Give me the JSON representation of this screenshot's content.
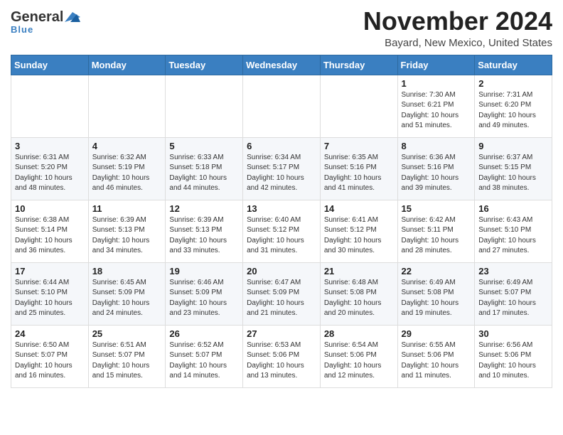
{
  "header": {
    "logo": {
      "general": "General",
      "blue": "Blue",
      "tagline": "Blue"
    },
    "month": "November 2024",
    "location": "Bayard, New Mexico, United States"
  },
  "weekdays": [
    "Sunday",
    "Monday",
    "Tuesday",
    "Wednesday",
    "Thursday",
    "Friday",
    "Saturday"
  ],
  "weeks": [
    [
      {
        "day": "",
        "info": ""
      },
      {
        "day": "",
        "info": ""
      },
      {
        "day": "",
        "info": ""
      },
      {
        "day": "",
        "info": ""
      },
      {
        "day": "",
        "info": ""
      },
      {
        "day": "1",
        "info": "Sunrise: 7:30 AM\nSunset: 6:21 PM\nDaylight: 10 hours\nand 51 minutes."
      },
      {
        "day": "2",
        "info": "Sunrise: 7:31 AM\nSunset: 6:20 PM\nDaylight: 10 hours\nand 49 minutes."
      }
    ],
    [
      {
        "day": "3",
        "info": "Sunrise: 6:31 AM\nSunset: 5:20 PM\nDaylight: 10 hours\nand 48 minutes."
      },
      {
        "day": "4",
        "info": "Sunrise: 6:32 AM\nSunset: 5:19 PM\nDaylight: 10 hours\nand 46 minutes."
      },
      {
        "day": "5",
        "info": "Sunrise: 6:33 AM\nSunset: 5:18 PM\nDaylight: 10 hours\nand 44 minutes."
      },
      {
        "day": "6",
        "info": "Sunrise: 6:34 AM\nSunset: 5:17 PM\nDaylight: 10 hours\nand 42 minutes."
      },
      {
        "day": "7",
        "info": "Sunrise: 6:35 AM\nSunset: 5:16 PM\nDaylight: 10 hours\nand 41 minutes."
      },
      {
        "day": "8",
        "info": "Sunrise: 6:36 AM\nSunset: 5:16 PM\nDaylight: 10 hours\nand 39 minutes."
      },
      {
        "day": "9",
        "info": "Sunrise: 6:37 AM\nSunset: 5:15 PM\nDaylight: 10 hours\nand 38 minutes."
      }
    ],
    [
      {
        "day": "10",
        "info": "Sunrise: 6:38 AM\nSunset: 5:14 PM\nDaylight: 10 hours\nand 36 minutes."
      },
      {
        "day": "11",
        "info": "Sunrise: 6:39 AM\nSunset: 5:13 PM\nDaylight: 10 hours\nand 34 minutes."
      },
      {
        "day": "12",
        "info": "Sunrise: 6:39 AM\nSunset: 5:13 PM\nDaylight: 10 hours\nand 33 minutes."
      },
      {
        "day": "13",
        "info": "Sunrise: 6:40 AM\nSunset: 5:12 PM\nDaylight: 10 hours\nand 31 minutes."
      },
      {
        "day": "14",
        "info": "Sunrise: 6:41 AM\nSunset: 5:12 PM\nDaylight: 10 hours\nand 30 minutes."
      },
      {
        "day": "15",
        "info": "Sunrise: 6:42 AM\nSunset: 5:11 PM\nDaylight: 10 hours\nand 28 minutes."
      },
      {
        "day": "16",
        "info": "Sunrise: 6:43 AM\nSunset: 5:10 PM\nDaylight: 10 hours\nand 27 minutes."
      }
    ],
    [
      {
        "day": "17",
        "info": "Sunrise: 6:44 AM\nSunset: 5:10 PM\nDaylight: 10 hours\nand 25 minutes."
      },
      {
        "day": "18",
        "info": "Sunrise: 6:45 AM\nSunset: 5:09 PM\nDaylight: 10 hours\nand 24 minutes."
      },
      {
        "day": "19",
        "info": "Sunrise: 6:46 AM\nSunset: 5:09 PM\nDaylight: 10 hours\nand 23 minutes."
      },
      {
        "day": "20",
        "info": "Sunrise: 6:47 AM\nSunset: 5:09 PM\nDaylight: 10 hours\nand 21 minutes."
      },
      {
        "day": "21",
        "info": "Sunrise: 6:48 AM\nSunset: 5:08 PM\nDaylight: 10 hours\nand 20 minutes."
      },
      {
        "day": "22",
        "info": "Sunrise: 6:49 AM\nSunset: 5:08 PM\nDaylight: 10 hours\nand 19 minutes."
      },
      {
        "day": "23",
        "info": "Sunrise: 6:49 AM\nSunset: 5:07 PM\nDaylight: 10 hours\nand 17 minutes."
      }
    ],
    [
      {
        "day": "24",
        "info": "Sunrise: 6:50 AM\nSunset: 5:07 PM\nDaylight: 10 hours\nand 16 minutes."
      },
      {
        "day": "25",
        "info": "Sunrise: 6:51 AM\nSunset: 5:07 PM\nDaylight: 10 hours\nand 15 minutes."
      },
      {
        "day": "26",
        "info": "Sunrise: 6:52 AM\nSunset: 5:07 PM\nDaylight: 10 hours\nand 14 minutes."
      },
      {
        "day": "27",
        "info": "Sunrise: 6:53 AM\nSunset: 5:06 PM\nDaylight: 10 hours\nand 13 minutes."
      },
      {
        "day": "28",
        "info": "Sunrise: 6:54 AM\nSunset: 5:06 PM\nDaylight: 10 hours\nand 12 minutes."
      },
      {
        "day": "29",
        "info": "Sunrise: 6:55 AM\nSunset: 5:06 PM\nDaylight: 10 hours\nand 11 minutes."
      },
      {
        "day": "30",
        "info": "Sunrise: 6:56 AM\nSunset: 5:06 PM\nDaylight: 10 hours\nand 10 minutes."
      }
    ]
  ]
}
